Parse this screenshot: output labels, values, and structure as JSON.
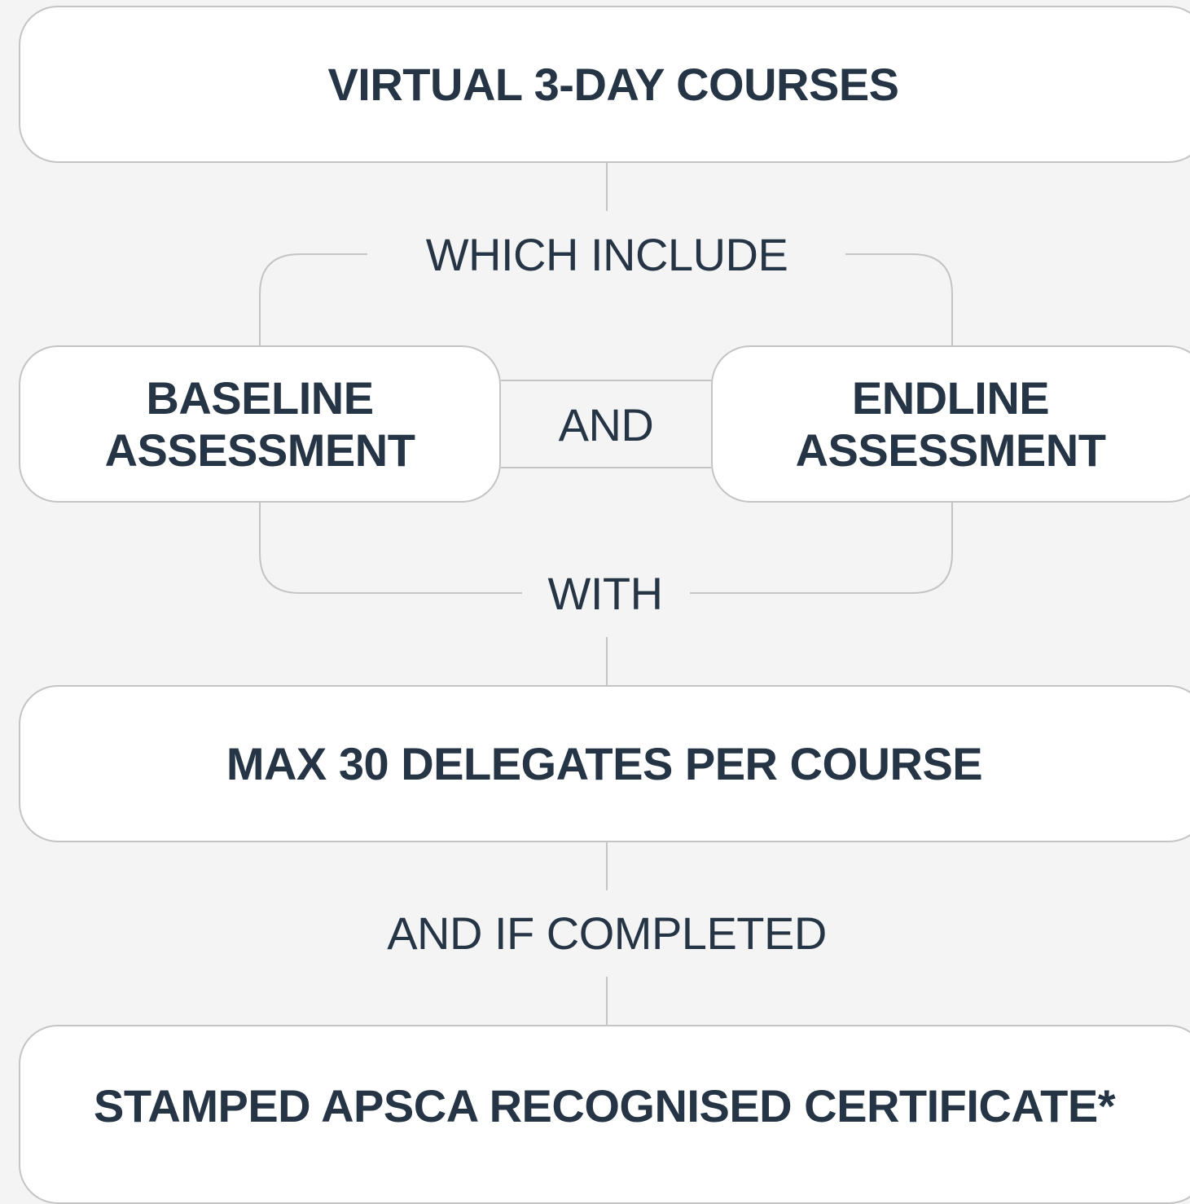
{
  "boxes": {
    "virtual": "VIRTUAL 3-DAY COURSES",
    "baseline": [
      "BASELINE",
      "ASSESSMENT"
    ],
    "endline": [
      "ENDLINE",
      "ASSESSMENT"
    ],
    "max_delegates": "MAX 30 DELEGATES PER COURSE",
    "certificate": "STAMPED APSCA RECOGNISED CERTIFICATE*"
  },
  "connectors": {
    "which_include": "WHICH INCLUDE",
    "and": "AND",
    "with": "WITH",
    "and_if_completed": "AND IF COMPLETED"
  },
  "colors": {
    "background": "#f4f4f4",
    "box_fill": "#ffffff",
    "border": "#c4c4c4",
    "text": "#263545"
  }
}
